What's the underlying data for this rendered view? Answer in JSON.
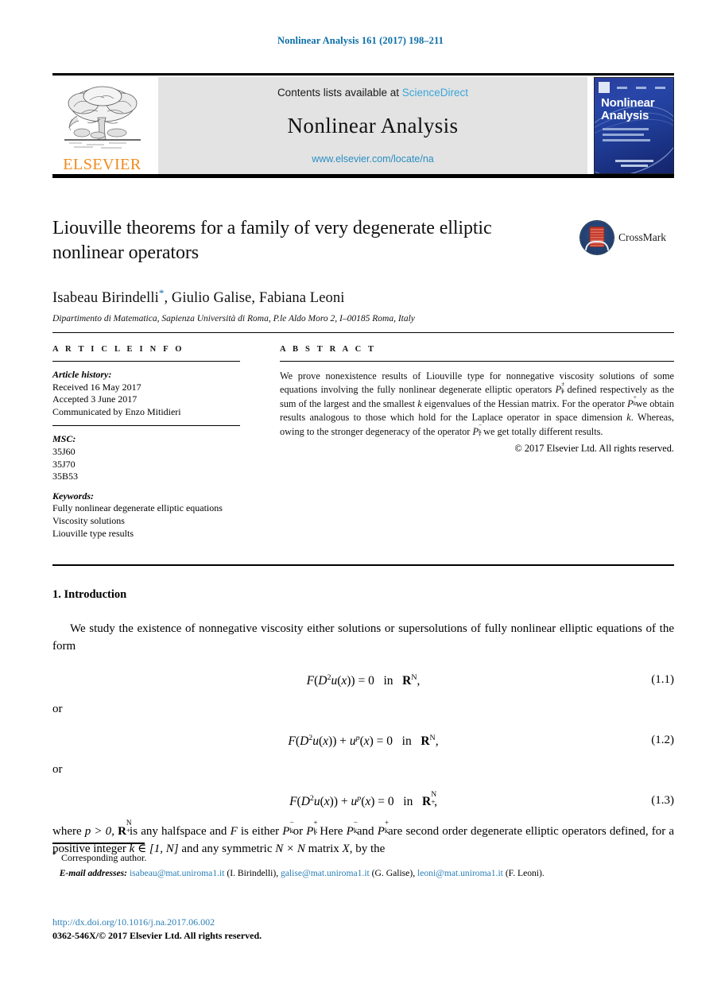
{
  "running_head": "Nonlinear Analysis 161 (2017) 198–211",
  "masthead": {
    "contents_prefix": "Contents lists available at ",
    "sciencedirect": "ScienceDirect",
    "journal_title": "Nonlinear Analysis",
    "journal_url": "www.elsevier.com/locate/na",
    "publisher": "ELSEVIER",
    "cover_title": "Nonlinear Analysis",
    "link_color": "#3aa6d8",
    "banner_bg": "#e3e3e3"
  },
  "article": {
    "title": "Liouville theorems for a family of very degenerate elliptic nonlinear operators",
    "crossmark_label": "CrossMark",
    "authors": "Isabeau Birindelli, Giulio Galise, Fabiana Leoni",
    "corresponding_marker": "*",
    "affiliation": "Dipartimento di Matematica, Sapienza Università di Roma, P.le Aldo Moro 2, I–00185 Roma, Italy"
  },
  "info": {
    "heading": "A R T I C L E   I N F O",
    "history_label": "Article history:",
    "history_lines": [
      "Received 16 May 2017",
      "Accepted 3 June 2017",
      "Communicated by Enzo Mitidieri"
    ],
    "msc_label": "MSC:",
    "msc_codes": [
      "35J60",
      "35J70",
      "35B53"
    ],
    "keywords_label": "Keywords:",
    "keywords": [
      "Fully nonlinear degenerate elliptic equations",
      "Viscosity solutions",
      "Liouville type results"
    ]
  },
  "abstract": {
    "heading": "A B S T R A C T",
    "text_part1": "We prove nonexistence results of Liouville type for nonnegative viscosity solutions of some equations involving the fully nonlinear degenerate elliptic operators ",
    "op_pm": "P",
    "text_part2": ", defined respectively as the sum of the largest and the smallest ",
    "k1": "k",
    "text_part3": " eigenvalues of the Hessian matrix. For the operator ",
    "text_part4": " we obtain results analogous to those which hold for the Laplace operator in space dimension ",
    "k2": "k",
    "text_part5": ". Whereas, owing to the stronger degeneracy of the operator ",
    "text_part6": ", we get totally different results.",
    "copyright": "© 2017 Elsevier Ltd. All rights reserved."
  },
  "body": {
    "section_number_title": "1. Introduction",
    "para1_a": "We study the existence of nonnegative viscosity either solutions or supersolutions of fully nonlinear elliptic equations of the form",
    "or_label_1": "or",
    "or_label_2": "or",
    "eq11": {
      "lhs": "F(D",
      "exp": "2",
      "mid": "u(x)) = 0",
      "in": "in",
      "domain": "R",
      "domain_sup": "N",
      "punct": ",",
      "number": "(1.1)"
    },
    "eq12": {
      "lhs": "F(D",
      "exp": "2",
      "mid": "u(x)) + u",
      "pexp": "p",
      "mid2": "(x) = 0",
      "in": "in",
      "domain": "R",
      "domain_sup": "N",
      "punct": ",",
      "number": "(1.2)"
    },
    "eq13": {
      "lhs": "F(D",
      "exp": "2",
      "mid": "u(x)) + u",
      "pexp": "p",
      "mid2": "(x) = 0",
      "in": "in",
      "domain": "R",
      "domain_sup": "N",
      "domain_sub": "+",
      "punct": ",",
      "number": "(1.3)"
    },
    "para2_a": "where ",
    "para2_p": "p > 0",
    "para2_b": " is any halfspace and ",
    "para2_F": "F",
    "para2_c": " is either ",
    "para2_d": " or ",
    "para2_e": ". Here ",
    "para2_f": " and ",
    "para2_g": " are second order degenerate elliptic operators defined, for a positive integer ",
    "para2_k": "k ∈ [1, N]",
    "para2_h": " and any symmetric ",
    "para2_NxN": "N × N",
    "para2_i": " matrix ",
    "para2_X": "X",
    "para2_j": ", by the"
  },
  "footnotes": {
    "corresponding": "Corresponding author.",
    "email_label": "E-mail addresses:",
    "emails": [
      {
        "address": "isabeau@mat.uniroma1.it",
        "owner": "(I. Birindelli)"
      },
      {
        "address": "galise@mat.uniroma1.it",
        "owner": "(G. Galise)"
      },
      {
        "address": "leoni@mat.uniroma1.it",
        "owner": "(F. Leoni)."
      }
    ],
    "doi": "http://dx.doi.org/10.1016/j.na.2017.06.002",
    "issn_line": "0362-546X/© 2017 Elsevier Ltd. All rights reserved."
  }
}
